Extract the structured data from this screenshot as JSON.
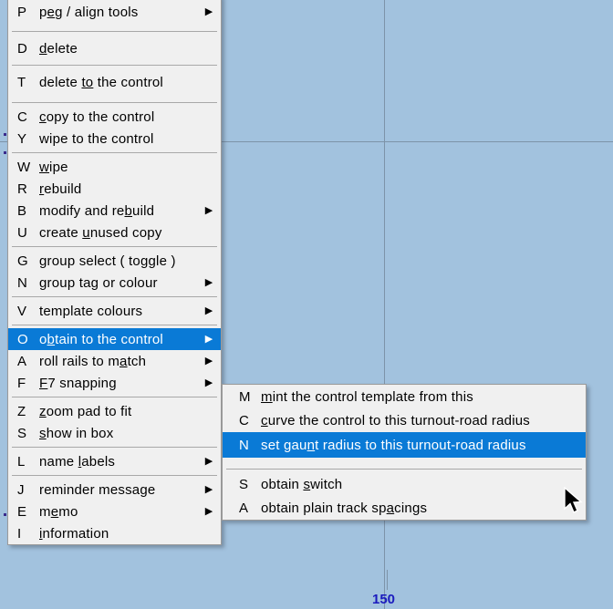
{
  "app": {
    "background_color": "#a2c2de",
    "menu_background": "#f0f0f0",
    "highlight_color": "#0a7ad6",
    "highlight_text_color": "#ffffff",
    "gridline_color": "#7d93a8",
    "tick_label_color": "#1b1bbe"
  },
  "canvas": {
    "ruler_label": "150",
    "gridlines_vertical": [
      421
    ],
    "gridlines_horizontal": [
      155
    ]
  },
  "main_menu": {
    "groups": [
      {
        "items": [
          {
            "key": "P",
            "label_pre": "p",
            "label_mnemonic": "e",
            "label_post": "g / align  tools",
            "submenu": true,
            "selected": false
          }
        ]
      },
      {
        "items": [
          {
            "key": "D",
            "label_pre": "",
            "label_mnemonic": "d",
            "label_post": "elete",
            "submenu": false,
            "selected": false
          }
        ]
      },
      {
        "items": [
          {
            "key": "T",
            "label_pre": "delete ",
            "label_mnemonic": "to",
            "label_post": "  the  control",
            "submenu": false,
            "selected": false
          }
        ]
      },
      {
        "items": [
          {
            "key": "C",
            "label_pre": "",
            "label_mnemonic": "c",
            "label_post": "opy  to  the  control",
            "submenu": false,
            "selected": false
          },
          {
            "key": "Y",
            "label_pre": "",
            "label_mnemonic": "",
            "label_post": "wipe  to  the  control",
            "submenu": false,
            "selected": false
          }
        ]
      },
      {
        "items": [
          {
            "key": "W",
            "label_pre": "",
            "label_mnemonic": "w",
            "label_post": "ipe",
            "submenu": false,
            "selected": false
          },
          {
            "key": "R",
            "label_pre": "",
            "label_mnemonic": "r",
            "label_post": "ebuild",
            "submenu": false,
            "selected": false
          },
          {
            "key": "B",
            "label_pre": "modify  and  re",
            "label_mnemonic": "b",
            "label_post": "uild",
            "submenu": true,
            "selected": false
          },
          {
            "key": "U",
            "label_pre": "create  ",
            "label_mnemonic": "u",
            "label_post": "nused  copy",
            "submenu": false,
            "selected": false
          }
        ]
      },
      {
        "items": [
          {
            "key": "G",
            "label_pre": "group  select  ( to",
            "label_mnemonic": "g",
            "label_post": "gle )",
            "submenu": false,
            "selected": false
          },
          {
            "key": "N",
            "label_pre": "",
            "label_mnemonic": "",
            "label_post": "group  tag  or  colour",
            "submenu": true,
            "selected": false
          }
        ]
      },
      {
        "items": [
          {
            "key": "V",
            "label_pre": "",
            "label_mnemonic": "",
            "label_post": "template  colours",
            "submenu": true,
            "selected": false
          }
        ]
      },
      {
        "items": [
          {
            "key": "O",
            "label_pre": "o",
            "label_mnemonic": "b",
            "label_post": "tain  to  the  control",
            "submenu": true,
            "selected": true
          },
          {
            "key": "A",
            "label_pre": "roll  rails  to  m",
            "label_mnemonic": "a",
            "label_post": "tch",
            "submenu": true,
            "selected": false
          },
          {
            "key": "F",
            "label_pre": "",
            "label_mnemonic": "F",
            "label_post": "7  snapping",
            "submenu": true,
            "selected": false
          }
        ]
      },
      {
        "items": [
          {
            "key": "Z",
            "label_pre": "",
            "label_mnemonic": "z",
            "label_post": "oom  pad  to  fit",
            "submenu": false,
            "selected": false
          },
          {
            "key": "S",
            "label_pre": "",
            "label_mnemonic": "s",
            "label_post": "how  in  box",
            "submenu": false,
            "selected": false
          }
        ]
      },
      {
        "items": [
          {
            "key": "L",
            "label_pre": "name  ",
            "label_mnemonic": "l",
            "label_post": "abels",
            "submenu": true,
            "selected": false
          }
        ]
      },
      {
        "items": [
          {
            "key": "J",
            "label_pre": "",
            "label_mnemonic": "",
            "label_post": "reminder  message",
            "submenu": true,
            "selected": false
          },
          {
            "key": "E",
            "label_pre": "m",
            "label_mnemonic": "e",
            "label_post": "mo",
            "submenu": true,
            "selected": false
          },
          {
            "key": "I",
            "label_pre": "",
            "label_mnemonic": "i",
            "label_post": "nformation",
            "submenu": false,
            "selected": false
          }
        ]
      }
    ]
  },
  "sub_menu": {
    "items": [
      {
        "key": "M",
        "label_pre": "",
        "label_mnemonic": "m",
        "label_post": "int  the  control  template  from  this",
        "selected": false
      },
      {
        "key": "C",
        "label_pre": "",
        "label_mnemonic": "c",
        "label_post": "urve  the  control  to  this  turnout-road  radius",
        "selected": false
      },
      {
        "key": "N",
        "label_pre": "set  gau",
        "label_mnemonic": "n",
        "label_post": "t  radius  to  this  turnout-road  radius",
        "selected": true
      },
      {
        "key": "S",
        "label_pre": "obtain  ",
        "label_mnemonic": "s",
        "label_post": "witch",
        "selected": false
      },
      {
        "key": "A",
        "label_pre": "obtain  plain  track  sp",
        "label_mnemonic": "a",
        "label_post": "cings",
        "selected": false
      }
    ]
  },
  "icons": {
    "submenu_arrow": "submenu-arrow-icon",
    "cursor": "mouse-pointer-icon"
  }
}
